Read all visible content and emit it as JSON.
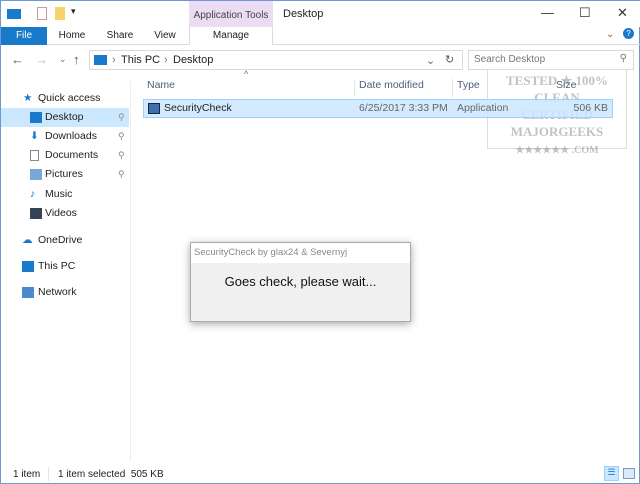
{
  "title": "Desktop",
  "ribbon": {
    "context_group": "Application Tools",
    "tabs": [
      "File",
      "Home",
      "Share",
      "View",
      "Manage"
    ]
  },
  "address": {
    "path": [
      "This PC",
      "Desktop"
    ],
    "search_placeholder": "Search Desktop"
  },
  "sidebar": {
    "items": [
      {
        "label": "Quick access",
        "icon": "star-icon"
      },
      {
        "label": "Desktop",
        "icon": "desktop-icon",
        "pinned": true,
        "selected": true
      },
      {
        "label": "Downloads",
        "icon": "download-icon",
        "pinned": true
      },
      {
        "label": "Documents",
        "icon": "documents-icon",
        "pinned": true
      },
      {
        "label": "Pictures",
        "icon": "pictures-icon",
        "pinned": true
      },
      {
        "label": "Music",
        "icon": "music-icon"
      },
      {
        "label": "Videos",
        "icon": "videos-icon"
      },
      {
        "label": "OneDrive",
        "icon": "cloud-icon"
      },
      {
        "label": "This PC",
        "icon": "computer-icon"
      },
      {
        "label": "Network",
        "icon": "network-icon"
      }
    ]
  },
  "columns": [
    "Name",
    "Date modified",
    "Type",
    "Size"
  ],
  "files": [
    {
      "name": "SecurityCheck",
      "date": "6/25/2017 3:33 PM",
      "type": "Application",
      "size": "506 KB"
    }
  ],
  "dialog": {
    "title": "SecurityCheck by glax24 & Severnyj",
    "message": "Goes check, please wait..."
  },
  "status": {
    "count": "1 item",
    "selection": "1 item selected  505 KB"
  },
  "watermark": "TESTED * 100% CLEAN CERTIFIED MAJORGEEKS .COM",
  "colors": {
    "accent": "#1979ca",
    "selection": "#cce8ff",
    "context": "#ecdcf3"
  }
}
